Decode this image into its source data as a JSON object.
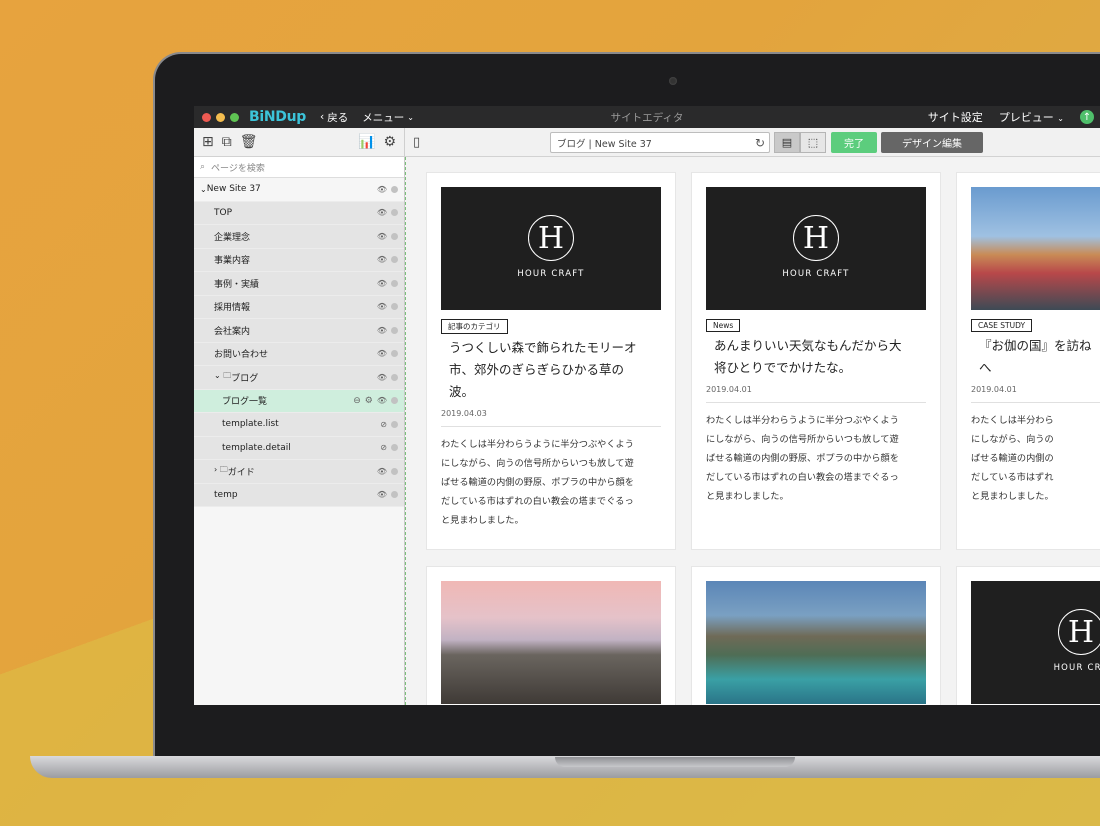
{
  "app": {
    "logo": "BiNDup",
    "back": "戻る",
    "menu": "メニュー",
    "window_title": "サイトエディタ",
    "site_settings": "サイト設定",
    "preview": "プレビュー",
    "upload_icon": "upload-icon"
  },
  "toolbar": {
    "url_text": "ブログ | New Site 37",
    "done": "完了",
    "design_edit": "デザイン編集"
  },
  "sidebar": {
    "search_placeholder": "ページを検索",
    "items": [
      {
        "label": "New Site 37",
        "indent": 0
      },
      {
        "label": "TOP",
        "indent": 1
      },
      {
        "label": "企業理念",
        "indent": 1
      },
      {
        "label": "事業内容",
        "indent": 1
      },
      {
        "label": "事例・実績",
        "indent": 1
      },
      {
        "label": "採用情報",
        "indent": 1
      },
      {
        "label": "会社案内",
        "indent": 1
      },
      {
        "label": "お問い合わせ",
        "indent": 1
      },
      {
        "label": "ブログ",
        "indent": 1
      },
      {
        "label": "ブログ一覧",
        "indent": 2
      },
      {
        "label": "template.list",
        "indent": 2
      },
      {
        "label": "template.detail",
        "indent": 2
      },
      {
        "label": "ガイド",
        "indent": 1
      },
      {
        "label": "temp",
        "indent": 1
      }
    ]
  },
  "cards": [
    {
      "thumb_text": "HOUR CRAFT",
      "thumb_mark": "H",
      "tag": "記事のカテゴリ",
      "title_lines": [
        "うつくしい森で飾られたモリーオ",
        "市、郊外のぎらぎらひかる草の",
        "波。"
      ],
      "date": "2019.04.03",
      "body_lines": [
        "わたくしは半分わらうように半分つぶやくよう",
        "にしながら、向うの信号所からいつも放して遊",
        "ばせる輸道の内側の野原、ポプラの中から顔を",
        "だしている市はずれの白い教会の塔までぐるっ",
        "と見まわしました。"
      ]
    },
    {
      "thumb_text": "HOUR CRAFT",
      "thumb_mark": "H",
      "tag": "News",
      "title_lines": [
        "あんまりいい天気なもんだから大",
        "将ひとりででかけたな。"
      ],
      "date": "2019.04.01",
      "body_lines": [
        "わたくしは半分わらうように半分つぶやくよう",
        "にしながら、向うの信号所からいつも放して遊",
        "ばせる輸道の内側の野原、ポプラの中から顔を",
        "だしている市はずれの白い教会の塔までぐるっ",
        "と見まわしました。"
      ]
    },
    {
      "tag": "CASE STUDY",
      "title_lines": [
        "『お伽の国』を訪ね",
        "へ"
      ],
      "date": "2019.04.01",
      "body_lines": [
        "わたくしは半分わら",
        "にしながら、向うの",
        "ばせる輸道の内側の",
        "だしている市はずれ",
        "と見まわしました。"
      ]
    }
  ],
  "card4_thumb_text": "HOUR CRA"
}
